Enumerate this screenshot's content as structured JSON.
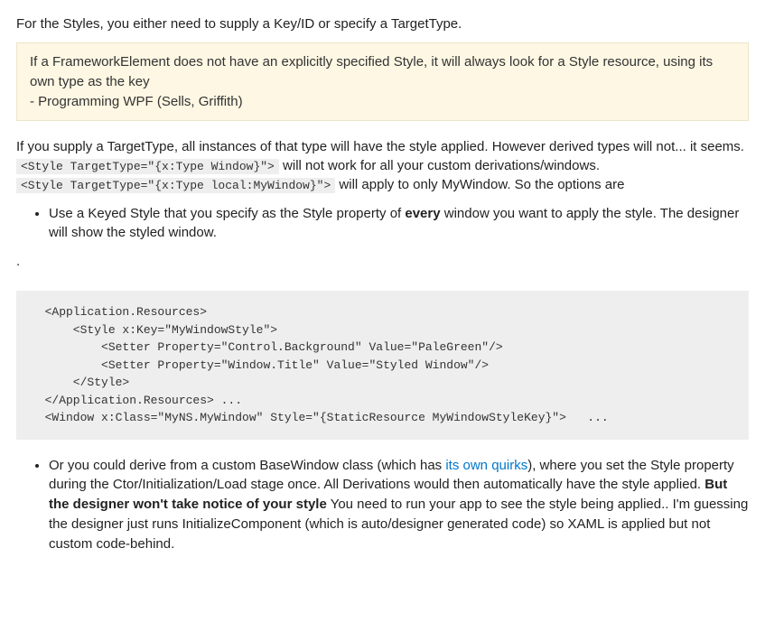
{
  "intro": "For the Styles, you either need to supply a Key/ID or specify a TargetType.",
  "quote": {
    "text": "If a FrameworkElement does not have an explicitly specified Style, it will always look for a Style resource, using its own type as the key",
    "attribution": "- Programming WPF (Sells, Griffith)"
  },
  "para2_a": "If you supply a TargetType, all instances of that type will have the style applied. However derived types will not... it seems. ",
  "code_inline_1": "<Style TargetType=\"{x:Type Window}\">",
  "para2_b": " will not work for all your custom derivations/windows. ",
  "code_inline_2": "<Style TargetType=\"{x:Type local:MyWindow}\">",
  "para2_c": " will apply to only MyWindow. So the options are",
  "bullet1_a": "Use a Keyed Style that you specify as the Style property of ",
  "bullet1_bold": "every",
  "bullet1_b": " window you want to apply the style. The designer will show the styled window.",
  "dot": ".",
  "codeblock": "  <Application.Resources>\n      <Style x:Key=\"MyWindowStyle\">\n          <Setter Property=\"Control.Background\" Value=\"PaleGreen\"/>\n          <Setter Property=\"Window.Title\" Value=\"Styled Window\"/>\n      </Style>\n  </Application.Resources> ...\n  <Window x:Class=\"MyNS.MyWindow\" Style=\"{StaticResource MyWindowStyleKey}\">   ...",
  "bullet2_a": "Or you could derive from a custom BaseWindow class (which has ",
  "bullet2_link": "its own quirks",
  "bullet2_b": "), where you set the Style property during the Ctor/Initialization/Load stage once. All Derivations would then automatically have the style applied. ",
  "bullet2_bold": "But the designer won't take notice of your style",
  "bullet2_c": " You need to run your app to see the style being applied.. I'm guessing the designer just runs InitializeComponent (which is auto/designer generated code) so XAML is applied but not custom code-behind."
}
